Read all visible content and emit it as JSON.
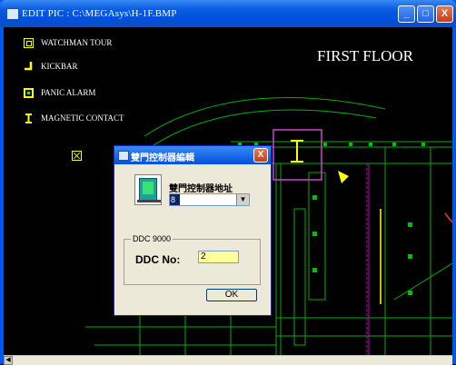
{
  "window": {
    "title": "EDIT PIC : C:\\MEGAsys\\H-1F.BMP",
    "minimize_glyph": "_",
    "maximize_glyph": "□",
    "close_glyph": "X"
  },
  "legend": [
    {
      "icon": "watchman-tour-icon",
      "label": "WATCHMAN TOUR"
    },
    {
      "icon": "kickbar-icon",
      "label": "KICKBAR"
    },
    {
      "icon": "panic-alarm-icon",
      "label": "PANIC ALARM"
    },
    {
      "icon": "magnetic-contact-icon",
      "label": "MAGNETIC CONTACT"
    }
  ],
  "floor_title": "FIRST FLOOR",
  "dialog": {
    "title": "雙門控制器編輯",
    "close_glyph": "X",
    "address_label": "雙門控制器地址",
    "address_value": "8",
    "group_label": "DDC 9000",
    "ddc_label": "DDC No:",
    "ddc_value": "2",
    "ok_label": "OK"
  },
  "colors": {
    "legend_icon": "#ffff00",
    "floorplan_lines": "#00c000",
    "highlight_box": "#d040d0",
    "magenta_line": "#c000c0",
    "background": "#000000"
  }
}
